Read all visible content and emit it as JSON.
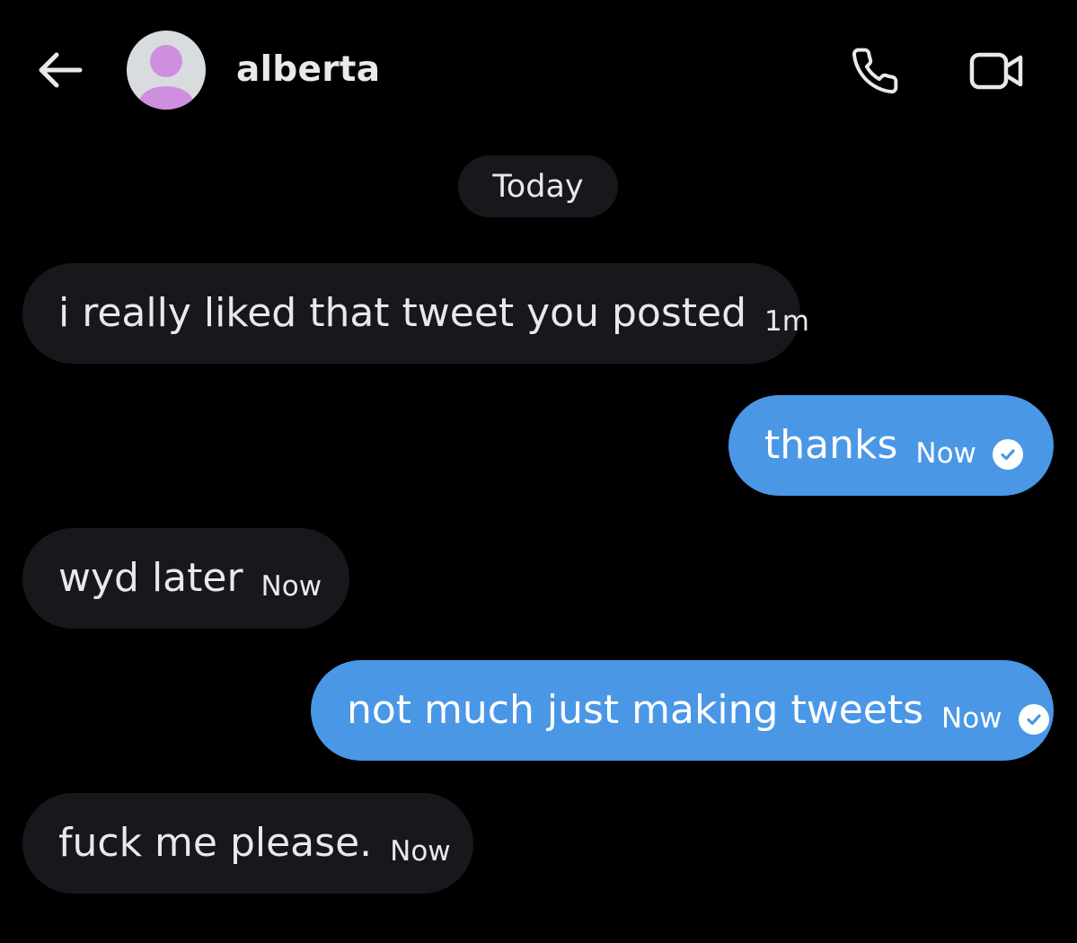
{
  "header": {
    "contact_name": "alberta",
    "back_icon": "arrow-left-icon",
    "call_icon": "phone-icon",
    "video_icon": "video-camera-icon",
    "avatar_icon": "default-avatar-icon"
  },
  "date_divider": "Today",
  "messages": [
    {
      "direction": "incoming",
      "text": "i really liked that tweet you posted",
      "time": "1m"
    },
    {
      "direction": "outgoing",
      "text": "thanks",
      "time": "Now",
      "status_icon": "check-circle-icon"
    },
    {
      "direction": "incoming",
      "text": "wyd later",
      "time": "Now"
    },
    {
      "direction": "outgoing",
      "text": "not much just making tweets",
      "time": "Now",
      "status_icon": "check-circle-icon"
    },
    {
      "direction": "incoming",
      "text": "fuck me please.",
      "time": "Now"
    }
  ],
  "colors": {
    "background": "#000000",
    "incoming_bubble": "#16181c",
    "outgoing_bubble": "#4a97e6",
    "text": "#e7e9ea",
    "avatar_bg": "#d9dcdf",
    "avatar_figure": "#cf8fdf"
  }
}
